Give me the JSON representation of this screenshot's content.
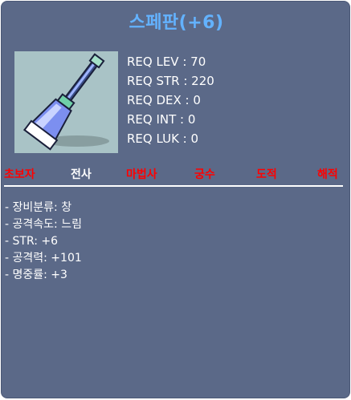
{
  "item": {
    "name": "스페판(+6)",
    "icon": "spear-icon"
  },
  "requirements": [
    {
      "label": "REQ LEV : 70"
    },
    {
      "label": "REQ STR : 220"
    },
    {
      "label": "REQ DEX : 0"
    },
    {
      "label": "REQ INT : 0"
    },
    {
      "label": "REQ LUK : 0"
    }
  ],
  "jobs": [
    {
      "label": "초보자",
      "available": false
    },
    {
      "label": "전사",
      "available": true
    },
    {
      "label": "마법사",
      "available": false
    },
    {
      "label": "궁수",
      "available": false
    },
    {
      "label": "도적",
      "available": false
    },
    {
      "label": "해적",
      "available": false
    }
  ],
  "stats": [
    {
      "label": "- 장비분류: 창"
    },
    {
      "label": "- 공격속도: 느림"
    },
    {
      "label": "- STR: +6"
    },
    {
      "label": "- 공격력: +101"
    },
    {
      "label": "- 명중률: +3"
    }
  ],
  "colors": {
    "panel": "#5b6988",
    "title": "#63b2ff",
    "unavailable_job": "#ff0000",
    "available_job": "#ffffff"
  }
}
